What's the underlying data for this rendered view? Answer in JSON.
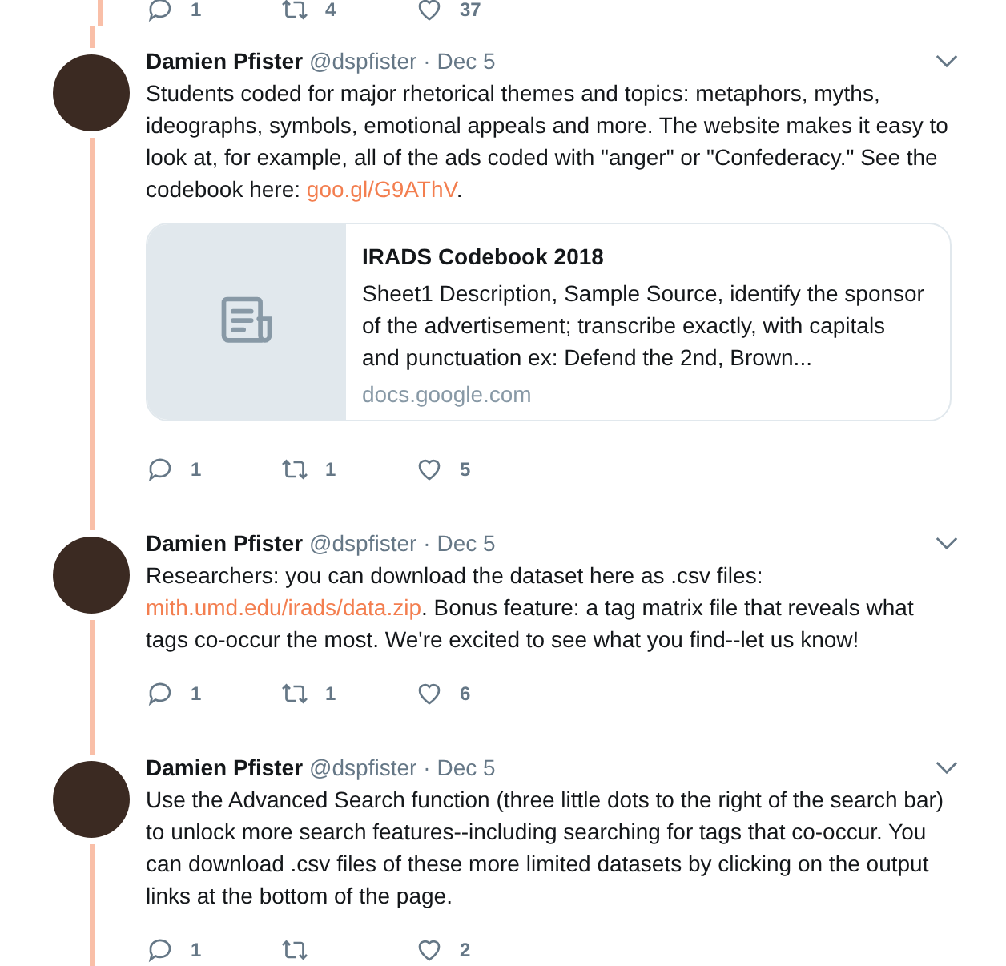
{
  "top_actions": {
    "replies": "1",
    "retweets": "4",
    "likes": "37"
  },
  "tweets": [
    {
      "name": "Damien Pfister",
      "handle": "@dspfister",
      "date": "· Dec 5",
      "segments": [
        {
          "kind": "text",
          "text": "Students coded for major rhetorical themes and topics: metaphors, myths, ideographs, symbols, emotional appeals and more. The website makes it easy to look at, for example, all of the ads coded with \"anger\" or \"Confederacy.\" See the codebook here: "
        },
        {
          "kind": "link",
          "text": "goo.gl/G9AThV"
        },
        {
          "kind": "text",
          "text": "."
        }
      ],
      "card": {
        "title": "IRADS Codebook 2018",
        "description": "Sheet1 Description, Sample Source, identify the sponsor of the advertisement; transcribe exactly, with capitals and punctuation ex: Defend the 2nd, Brown...",
        "domain": "docs.google.com"
      },
      "replies": "1",
      "retweets": "1",
      "likes": "5"
    },
    {
      "name": "Damien Pfister",
      "handle": "@dspfister",
      "date": "· Dec 5",
      "segments": [
        {
          "kind": "text",
          "text": "Researchers: you can download the dataset here as .csv files: "
        },
        {
          "kind": "link",
          "text": "mith.umd.edu/irads/data.zip"
        },
        {
          "kind": "text",
          "text": ". Bonus feature: a tag matrix file that reveals what tags co-occur the most. We're excited to see what you find--let us know!"
        }
      ],
      "replies": "1",
      "retweets": "1",
      "likes": "6"
    },
    {
      "name": "Damien Pfister",
      "handle": "@dspfister",
      "date": "· Dec 5",
      "segments": [
        {
          "kind": "text",
          "text": "Use the Advanced Search function (three little dots to the right of the search bar) to unlock more search features--including searching for tags that co-occur. You can download .csv files of these more limited datasets by clicking on the output links at the bottom of the page."
        }
      ],
      "replies": "1",
      "likes": "2"
    }
  ]
}
